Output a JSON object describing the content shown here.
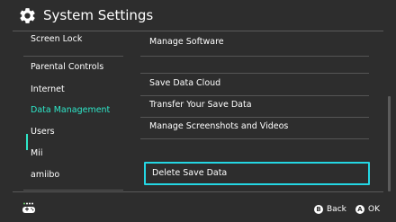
{
  "header": {
    "title": "System Settings",
    "icon": "gear-icon"
  },
  "sidebar": {
    "items": [
      {
        "label": "Screen Lock"
      },
      {
        "label": "Parental Controls"
      },
      {
        "label": "Internet"
      },
      {
        "label": "Data Management",
        "active": true
      },
      {
        "label": "Users"
      },
      {
        "label": "Mii"
      },
      {
        "label": "amiibo"
      }
    ]
  },
  "content": {
    "items": [
      {
        "label": "Manage Software"
      },
      {
        "label": "Save Data Cloud"
      },
      {
        "label": "Transfer Your Save Data"
      },
      {
        "label": "Manage Screenshots and Videos"
      },
      {
        "label": "Delete Save Data",
        "selected": true
      }
    ]
  },
  "footer": {
    "back": {
      "button": "B",
      "label": "Back"
    },
    "ok": {
      "button": "A",
      "label": "OK"
    }
  },
  "colors": {
    "background": "#2d2d2d",
    "accent_active": "#2ee6c8",
    "selection_border": "#24d6e3"
  }
}
